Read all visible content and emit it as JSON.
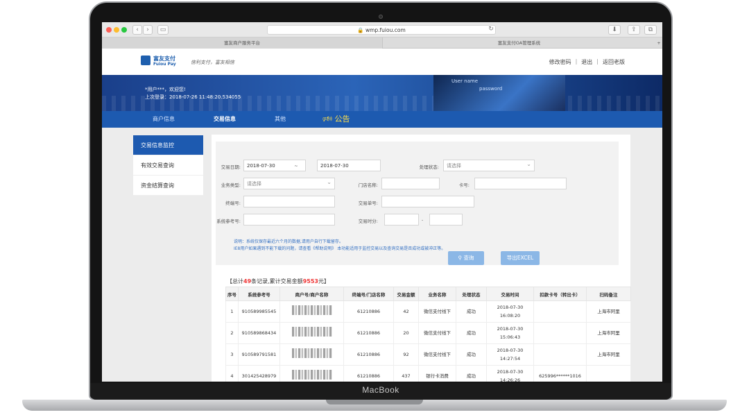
{
  "device": {
    "brand": "MacBook"
  },
  "browser": {
    "url": "wmp.fuiou.com",
    "tabs": [
      "富友商户服务平台",
      "富友支付OA管理系统"
    ]
  },
  "site": {
    "logo_cn": "富友支付",
    "logo_en": "Fuiou Pay",
    "slogan": "信利支付，富友相信",
    "top_links": [
      "修改密码",
      "退出",
      "返回老版"
    ],
    "welcome": "*用户***，欢迎您!",
    "last_login": "上次登录：2018-07-26 11:48:20.534055",
    "banner_text": [
      "User name",
      "password"
    ],
    "nav": [
      "商户信息",
      "交易信息",
      "其他"
    ],
    "notice": "公告"
  },
  "sidebar": {
    "items": [
      {
        "label": "交易信息监控"
      },
      {
        "label": "有效交易查询"
      },
      {
        "label": "资金结算查询"
      }
    ]
  },
  "filter": {
    "trade_date_label": "交易日期:",
    "date_from": "2018-07-30",
    "date_to": "2018-07-30",
    "date_sep": "~",
    "status_label": "处理状态:",
    "status_value": "请选择",
    "biz_type_label": "业务类型:",
    "biz_type_value": "请选择",
    "store_label": "门店名称:",
    "card_label": "卡号:",
    "terminal_label": "终端号:",
    "trade_no_label": "交易单号:",
    "ref_label": "系统参考号:",
    "time_label": "交易时分:",
    "time_sep": "-",
    "note1": "说明：系统仅保存最近六个月的数据,请用户自行下载留存。",
    "note2": "IE8用户如果遇到不能下载的问题，请查看《帮助说明》 本功能适用于监控交易以及查询交易是否成功或被冲正等。",
    "query_btn": "查询",
    "export_btn": "导出EXCEL"
  },
  "summary": {
    "prefix": "【总计",
    "count": "49",
    "mid": "条记录,累计交易金额",
    "amount": "9553",
    "suffix": "元】"
  },
  "table": {
    "headers": [
      "序号",
      "系统参考号",
      "商户号/商户名称",
      "终端号/门店名称",
      "交易金额",
      "业务名称",
      "处理状态",
      "交易时间",
      "扣款卡号（转出卡）",
      "扫码备注"
    ],
    "rows": [
      {
        "no": "1",
        "ref": "910589985545",
        "terminal": "61210886",
        "amount": "42",
        "biz": "微信支付线下",
        "status": "成功",
        "date": "2018-07-30",
        "time": "16:08:20",
        "card": "",
        "remark": "上海市阿里"
      },
      {
        "no": "2",
        "ref": "910589868434",
        "terminal": "61210886",
        "amount": "20",
        "biz": "微信支付线下",
        "status": "成功",
        "date": "2018-07-30",
        "time": "15:06:43",
        "card": "",
        "remark": "上海市阿里"
      },
      {
        "no": "3",
        "ref": "910589791581",
        "terminal": "61210886",
        "amount": "92",
        "biz": "微信支付线下",
        "status": "成功",
        "date": "2018-07-30",
        "time": "14:27:54",
        "card": "",
        "remark": "上海市阿里"
      },
      {
        "no": "4",
        "ref": "301425428979",
        "terminal": "61210886",
        "amount": "437",
        "biz": "银行卡消费",
        "status": "成功",
        "date": "2018-07-30",
        "time": "14:26:26",
        "card": "625996******1016",
        "remark": ""
      }
    ]
  },
  "colors": {
    "primary": "#1d5ab0",
    "accent_red": "#e33333",
    "notice_yellow": "#ffe04a"
  }
}
